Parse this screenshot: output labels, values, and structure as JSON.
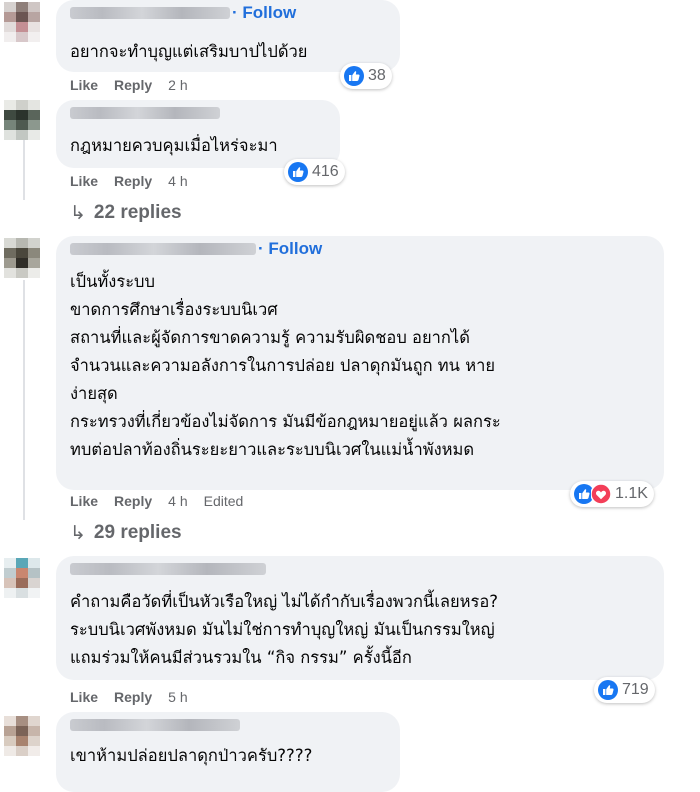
{
  "comments": [
    {
      "follow_label": "Follow",
      "text": "อยากจะทำบุญแต่เสริมบาปไปด้วย",
      "actions": {
        "like": "Like",
        "reply": "Reply",
        "time": "2 h"
      },
      "reaction_count": "38",
      "reaction_icons": [
        "like-icon"
      ]
    },
    {
      "text": "กฎหมายควบคุมเมื่อไหร่จะมา",
      "actions": {
        "like": "Like",
        "reply": "Reply",
        "time": "4 h"
      },
      "reaction_count": "416",
      "reaction_icons": [
        "like-icon"
      ],
      "replies_label": "22 replies"
    },
    {
      "follow_label": "Follow",
      "text": "เป็นทั้งระบบ\nขาดการศึกษาเรื่องระบบนิเวศ\nสถานที่และผู้จัดการขาดความรู้ ความรับผิดชอบ อยากได้\nจำนวนและความอลังการในการปล่อย ปลาดุกมันถูก ทน หาย\nง่ายสุด\nกระทรวงที่เกี่ยวข้องไม่จัดการ มันมีข้อกฎหมายอยู่แล้ว ผลกระ\nทบต่อปลาท้องถิ่นระยะยาวและระบบนิเวศในแม่น้ำพังหมด",
      "actions": {
        "like": "Like",
        "reply": "Reply",
        "time": "4 h",
        "edited": "Edited"
      },
      "reaction_count": "1.1K",
      "reaction_icons": [
        "like-icon",
        "love-icon"
      ],
      "replies_label": "29 replies"
    },
    {
      "text": "คำถามคือวัดที่เป็นหัวเรือใหญ่ ไม่ได้กำกับเรื่องพวกนี้เลยหรอ?\nระบบนิเวศพังหมด มันไม่ใช่การทำบุญใหญ่ มันเป็นกรรมใหญ่\nแถมร่วมให้คนมีส่วนรวมใน “กิจ กรรม” ครั้งนี้อีก",
      "actions": {
        "like": "Like",
        "reply": "Reply",
        "time": "5 h"
      },
      "reaction_count": "719",
      "reaction_icons": [
        "like-icon"
      ]
    },
    {
      "text": "เขาห้ามปล่อยปลาดุกป่าวครับ????"
    }
  ],
  "colors": {
    "bubble": "#f0f2f5",
    "link": "#216fdb",
    "meta": "#65676b",
    "like": "#1877f2",
    "love": "#f33e58"
  }
}
